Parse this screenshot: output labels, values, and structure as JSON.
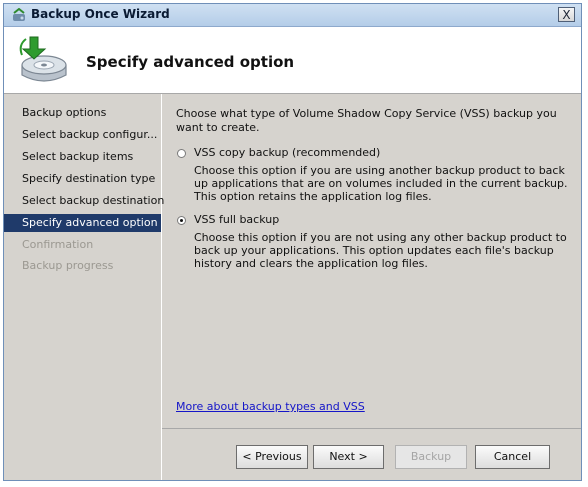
{
  "window": {
    "title": "Backup Once Wizard",
    "close_glyph": "X"
  },
  "header": {
    "title": "Specify advanced option",
    "icon": "backup-disk-arrow-icon"
  },
  "nav": {
    "items": [
      {
        "label": "Backup options",
        "state": "normal"
      },
      {
        "label": "Select backup configur...",
        "state": "normal"
      },
      {
        "label": "Select backup items",
        "state": "normal"
      },
      {
        "label": "Specify destination type",
        "state": "normal"
      },
      {
        "label": "Select backup destination",
        "state": "normal"
      },
      {
        "label": "Specify advanced option",
        "state": "selected"
      },
      {
        "label": "Confirmation",
        "state": "disabled"
      },
      {
        "label": "Backup progress",
        "state": "disabled"
      }
    ]
  },
  "content": {
    "intro": "Choose what type of Volume Shadow Copy Service (VSS) backup you want to create.",
    "options": [
      {
        "label": "VSS copy backup (recommended)",
        "selected": false,
        "description": "Choose this option if you are using another backup product to back up applications that are on volumes included in the current backup. This option retains the application log files."
      },
      {
        "label": "VSS full backup",
        "selected": true,
        "description": "Choose this option if you are not using any other backup product to back up your applications. This option updates each file's backup history and clears the application log files."
      }
    ],
    "link": "More about backup types and VSS"
  },
  "buttons": {
    "previous": "< Previous",
    "next": "Next >",
    "backup": "Backup",
    "cancel": "Cancel"
  },
  "colors": {
    "selected_nav": "#1f3a6a",
    "link": "#1515c8"
  }
}
